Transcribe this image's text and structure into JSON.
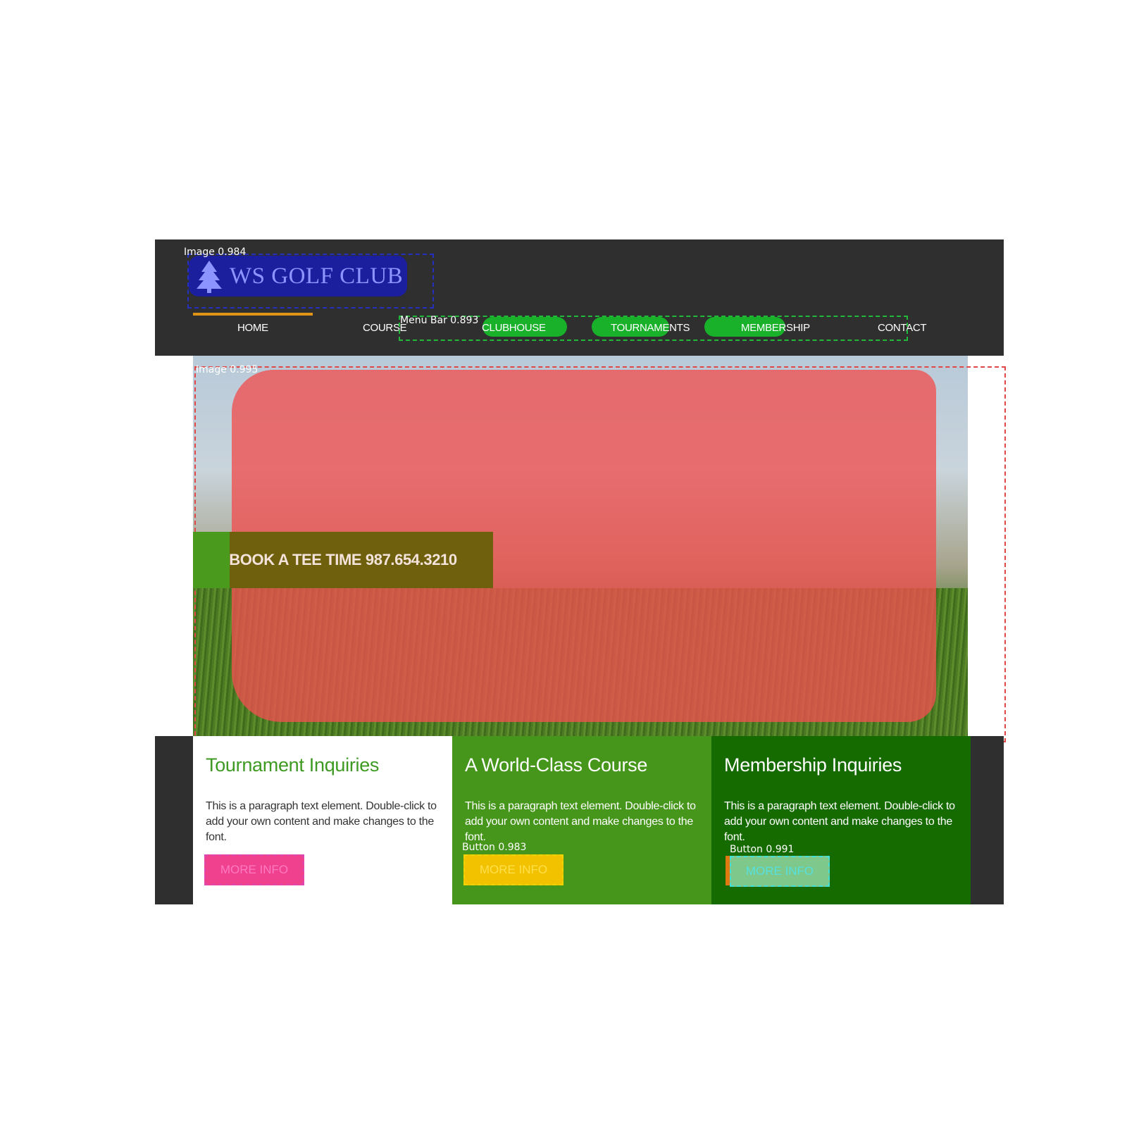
{
  "header": {
    "logo_text": "WS GOLF CLUB",
    "logo_label": "Image 0.984"
  },
  "menu": {
    "label": "Menu Bar 0.893",
    "items": [
      "HOME",
      "COURSE",
      "CLUBHOUSE",
      "TOURNAMENTS",
      "MEMBERSHIP",
      "CONTACT"
    ]
  },
  "hero": {
    "label": "Image 0.995",
    "cta": "BOOK A TEE TIME 987.654.3210"
  },
  "panels": [
    {
      "title": "Tournament Inquiries",
      "text": "This is a paragraph text element. Double-click to add your own content and make changes to the font.",
      "button": "MORE INFO",
      "button_label": "Button 0.991"
    },
    {
      "title": "A World-Class Course",
      "text": "This is a paragraph text element. Double-click to add your own content and make changes to the font.",
      "button": "MORE INFO",
      "button_label": "Button 0.983"
    },
    {
      "title": "Membership Inquiries",
      "text": "This is a paragraph text element. Double-click to add your own content and make changes to the font.",
      "button": "MORE INFO",
      "button_label": "Button 0.991"
    }
  ],
  "colors": {
    "header_bg": "#2f2f2f",
    "accent_orange": "#e09416",
    "green": "#45961a",
    "dark_green": "#156b00"
  }
}
